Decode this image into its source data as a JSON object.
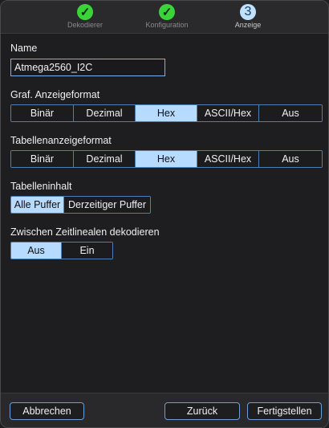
{
  "stepper": {
    "steps": [
      {
        "label": "Dekodierer",
        "state": "done",
        "icon": "checkmark-icon"
      },
      {
        "label": "Konfiguration",
        "state": "done",
        "icon": "checkmark-icon"
      },
      {
        "label": "Anzeige",
        "state": "active",
        "number": "3"
      }
    ]
  },
  "name": {
    "label": "Name",
    "value": "Atmega2560_I2C"
  },
  "graf_format": {
    "label": "Graf. Anzeigeformat",
    "options": [
      "Binär",
      "Dezimal",
      "Hex",
      "ASCII/Hex",
      "Aus"
    ],
    "selected": "Hex"
  },
  "table_format": {
    "label": "Tabellenanzeigeformat",
    "options": [
      "Binär",
      "Dezimal",
      "Hex",
      "ASCII/Hex",
      "Aus"
    ],
    "selected": "Hex"
  },
  "table_content": {
    "label": "Tabelleninhalt",
    "options": [
      "Alle Puffer",
      "Derzeitiger Puffer"
    ],
    "selected": "Alle Puffer"
  },
  "decode_between": {
    "label": "Zwischen Zeitlinealen dekodieren",
    "options": [
      "Aus",
      "Ein"
    ],
    "selected": "Aus"
  },
  "footer": {
    "cancel": "Abbrechen",
    "back": "Zurück",
    "finish": "Fertigstellen"
  },
  "colors": {
    "accent": "#b7dbff",
    "border": "#4b7fb8",
    "done": "#3ad43a"
  }
}
